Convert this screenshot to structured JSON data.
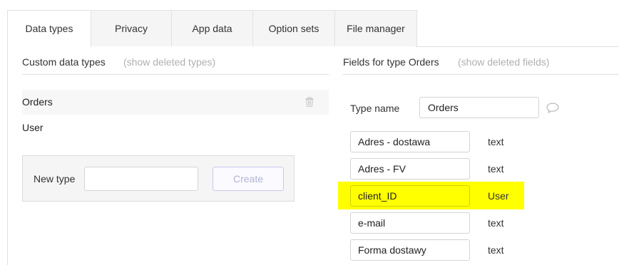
{
  "tabs": [
    {
      "label": "Data types",
      "active": true
    },
    {
      "label": "Privacy"
    },
    {
      "label": "App data"
    },
    {
      "label": "Option sets"
    },
    {
      "label": "File manager"
    }
  ],
  "left": {
    "title": "Custom data types",
    "hint": "(show deleted types)",
    "types": [
      "Orders",
      "User"
    ],
    "selected": "Orders",
    "new_type": {
      "label": "New type",
      "value": "",
      "button": "Create"
    }
  },
  "right": {
    "title": "Fields for type Orders",
    "hint": "(show deleted fields)",
    "type_name_label": "Type name",
    "type_name_value": "Orders",
    "fields": [
      {
        "name": "Adres - dostawa",
        "type": "text"
      },
      {
        "name": "Adres - FV",
        "type": "text"
      },
      {
        "name": "client_ID",
        "type": "User",
        "highlight_color": "#ffff00"
      },
      {
        "name": "e-mail",
        "type": "text"
      },
      {
        "name": "Forma dostawy",
        "type": "text"
      }
    ]
  },
  "icons": {
    "delete": "trash-icon",
    "comment": "comment-icon"
  }
}
